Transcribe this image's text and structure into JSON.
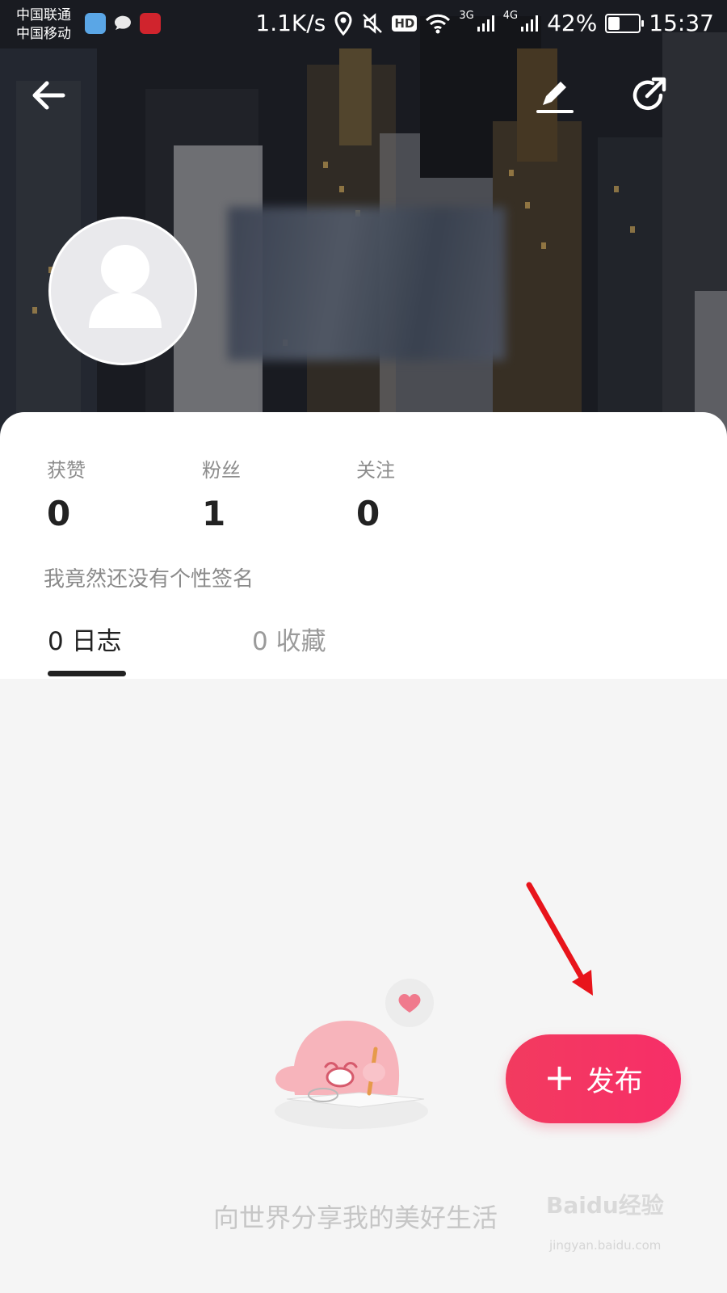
{
  "status_bar": {
    "carrier_1": "中国联通",
    "carrier_2": "中国移动",
    "speed": "1.1K/s",
    "signal_3g": "3G",
    "signal_4g": "4G",
    "hd": "HD",
    "battery_percent": "42%",
    "battery_level": 0.42,
    "time": "15:37"
  },
  "profile": {
    "stats": [
      {
        "label": "获赞",
        "value": "0"
      },
      {
        "label": "粉丝",
        "value": "1"
      },
      {
        "label": "关注",
        "value": "0"
      }
    ],
    "bio": "我竟然还没有个性签名"
  },
  "tabs": [
    {
      "label": "0 日志",
      "active": true
    },
    {
      "label": "0 收藏",
      "active": false
    }
  ],
  "empty_state": {
    "message": "向世界分享我的美好生活"
  },
  "publish": {
    "plus": "+",
    "label": "发布"
  },
  "watermark": {
    "text": "Baidu经验",
    "sub": "jingyan.baidu.com"
  },
  "icons": {
    "back": "arrow-left-icon",
    "edit": "pencil-icon",
    "share": "share-icon",
    "avatar": "user-silhouette-icon"
  },
  "colors": {
    "accent": "#f23b5f",
    "annotation_arrow": "#e8141b"
  }
}
